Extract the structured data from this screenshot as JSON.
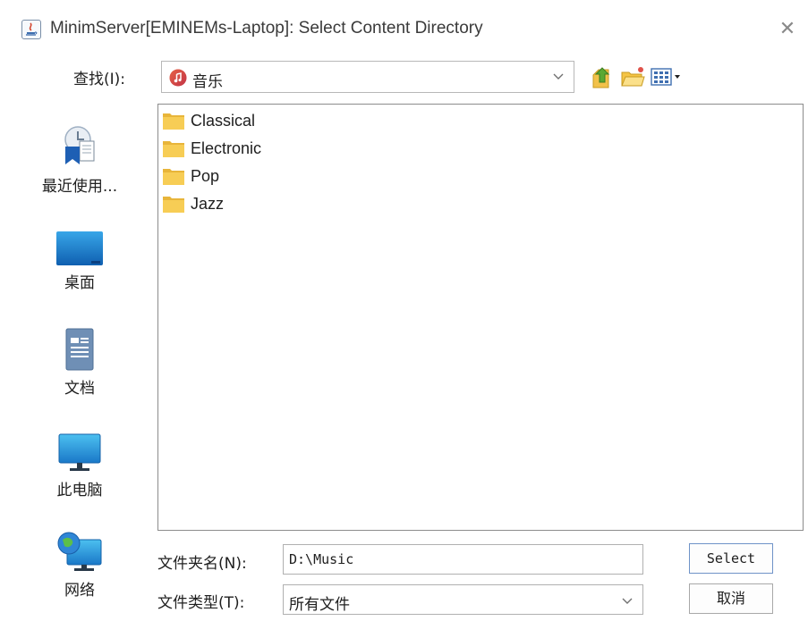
{
  "window": {
    "title": "MinimServer[EMINEMs-Laptop]: Select Content Directory",
    "close_glyph": "✕",
    "icon": "java-app-icon"
  },
  "lookin": {
    "label": "查找(I):",
    "value": "音乐",
    "value_icon": "music-icon",
    "toolbar": [
      "up-folder-icon",
      "new-folder-icon",
      "view-menu-icon"
    ]
  },
  "places": [
    {
      "label": "最近使用...",
      "icon": "recent-icon"
    },
    {
      "label": "桌面",
      "icon": "desktop-icon"
    },
    {
      "label": "文档",
      "icon": "documents-icon"
    },
    {
      "label": "此电脑",
      "icon": "computer-icon"
    },
    {
      "label": "网络",
      "icon": "network-icon"
    }
  ],
  "files": [
    {
      "name": "Classical"
    },
    {
      "name": "Electronic"
    },
    {
      "name": "Pop"
    },
    {
      "name": "Jazz"
    }
  ],
  "folder_name": {
    "label": "文件夹名(N):",
    "value": "D:\\Music"
  },
  "file_type": {
    "label": "文件类型(T):",
    "value": "所有文件"
  },
  "buttons": {
    "select": "Select",
    "cancel": "取消"
  },
  "colors": {
    "folder_yellow": "#f5c445",
    "selection_border": "#6f93c8",
    "desktop_blue": "#1976c8"
  }
}
